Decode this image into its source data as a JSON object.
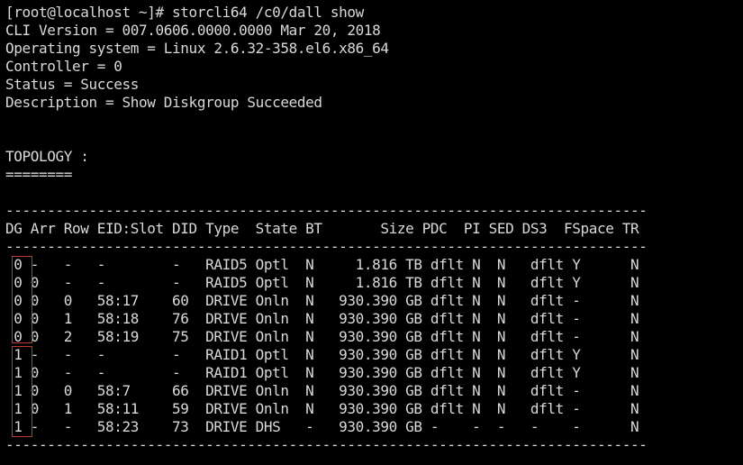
{
  "terminal": {
    "lines": [
      "[root@localhost ~]# storcli64 /c0/dall show",
      "CLI Version = 007.0606.0000.0000 Mar 20, 2018",
      "Operating system = Linux 2.6.32-358.el6.x86_64",
      "Controller = 0",
      "Status = Success",
      "Description = Show Diskgroup Succeeded",
      "",
      "",
      "TOPOLOGY :",
      "========",
      "",
      "-----------------------------------------------------------------------------",
      "DG Arr Row EID:Slot DID Type  State BT       Size PDC  PI SED DS3  FSpace TR",
      "-----------------------------------------------------------------------------",
      " 0 -   -   -        -   RAID5 Optl  N     1.816 TB dflt N  N   dflt Y      N",
      " 0 0   -   -        -   RAID5 Optl  N     1.816 TB dflt N  N   dflt Y      N",
      " 0 0   0   58:17    60  DRIVE Onln  N   930.390 GB dflt N  N   dflt -      N",
      " 0 0   1   58:18    76  DRIVE Onln  N   930.390 GB dflt N  N   dflt -      N",
      " 0 0   2   58:19    75  DRIVE Onln  N   930.390 GB dflt N  N   dflt -      N",
      " 1 -   -   -        -   RAID1 Optl  N   930.390 GB dflt N  N   dflt Y      N",
      " 1 0   -   -        -   RAID1 Optl  N   930.390 GB dflt N  N   dflt Y      N",
      " 1 0   0   58:7     66  DRIVE Onln  N   930.390 GB dflt N  N   dflt -      N",
      " 1 0   1   58:11    59  DRIVE Onln  N   930.390 GB dflt N  N   dflt -      N",
      " 1 -   -   58:23    73  DRIVE DHS   -   930.390 GB -    -  -   -    -      N",
      "-----------------------------------------------------------------------------"
    ]
  },
  "colors": {
    "background": "#000000",
    "text": "#d9d9d9",
    "highlight": "#c0392b"
  }
}
